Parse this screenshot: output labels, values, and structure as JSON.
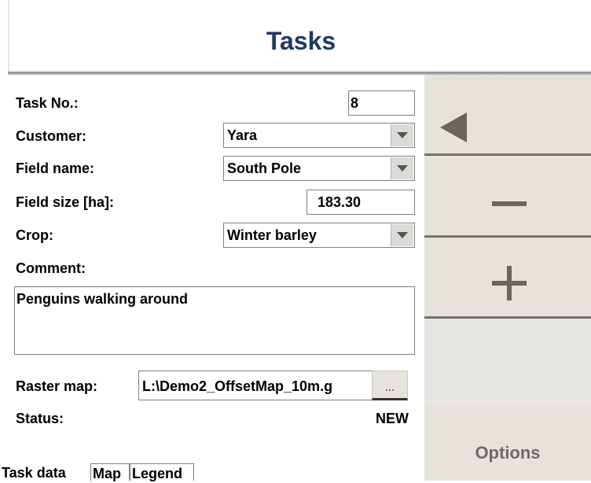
{
  "header": {
    "title": "Tasks"
  },
  "form": {
    "task_no": {
      "label": "Task No.:",
      "value": "8"
    },
    "customer": {
      "label": "Customer:",
      "value": "Yara"
    },
    "field_name": {
      "label": "Field name:",
      "value": "South Pole"
    },
    "field_size": {
      "label": "Field size [ha]:",
      "value": "183.30"
    },
    "crop": {
      "label": "Crop:",
      "value": "Winter barley"
    },
    "comment": {
      "label": "Comment:",
      "value": "Penguins walking around"
    },
    "raster_map": {
      "label": "Raster map:",
      "value": "L:\\Demo2_OffsetMap_10m.g",
      "browse_label": "..."
    },
    "status": {
      "label": "Status:",
      "value": "NEW"
    }
  },
  "tabs": [
    {
      "label": "Task data"
    },
    {
      "label": "Map"
    },
    {
      "label": "Legend"
    }
  ],
  "panel": {
    "back_icon": "triangle-left-icon",
    "minus_icon": "minus-icon",
    "plus_icon": "plus-icon",
    "options_label": "Options"
  },
  "colors": {
    "title": "#1f3864",
    "panel_bg": "#e6e3dd",
    "icon": "#6b655a"
  }
}
